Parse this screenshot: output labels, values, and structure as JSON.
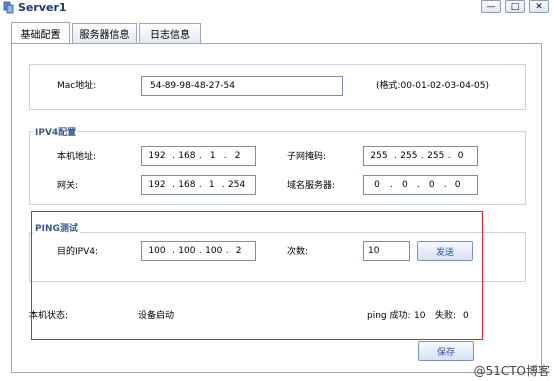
{
  "window": {
    "title": "Server1",
    "controls": {
      "minimize": "—",
      "maximize": "□",
      "close": "✕"
    }
  },
  "tabs": [
    "基础配置",
    "服务器信息",
    "日志信息"
  ],
  "mac": {
    "label": "Mac地址:",
    "value": "54-89-98-48-27-54",
    "hint": "(格式:00-01-02-03-04-05)"
  },
  "ipv4": {
    "legend": "IPV4配置",
    "local_ip_label": "本机地址:",
    "local_ip": [
      "192",
      "168",
      "1",
      "2"
    ],
    "subnet_label": "子网掩码:",
    "subnet": [
      "255",
      "255",
      "255",
      "0"
    ],
    "gateway_label": "网关:",
    "gateway": [
      "192",
      "168",
      "1",
      "254"
    ],
    "dns_label": "域名服务器:",
    "dns": [
      "0",
      "0",
      "0",
      "0"
    ]
  },
  "ping": {
    "legend": "PING测试",
    "target_label": "目的IPV4:",
    "target": [
      "100",
      "100",
      "100",
      "2"
    ],
    "count_label": "次数:",
    "count": "10",
    "send_label": "发送"
  },
  "status": {
    "label": "本机状态:",
    "value": "设备启动",
    "ping_success_label": "ping 成功:",
    "ping_success": "10",
    "fail_label": "失败:",
    "fail": "0"
  },
  "save_label": "保存",
  "watermark": "@51CTO博客"
}
